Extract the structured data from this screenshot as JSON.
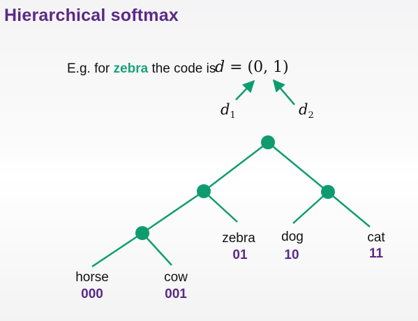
{
  "title": "Hierarchical softmax",
  "example": {
    "prefix": "E.g. for ",
    "word": "zebra",
    "suffix": " the code is",
    "equation": {
      "lhs": "d",
      "equals": " = ",
      "tuple": "(0, 1)"
    },
    "symbol1": {
      "base": "d",
      "sub": "1"
    },
    "symbol2": {
      "base": "d",
      "sub": "2"
    }
  },
  "tree": {
    "leaves": [
      {
        "word": "horse",
        "code": "000"
      },
      {
        "word": "cow",
        "code": "001"
      },
      {
        "word": "zebra",
        "code": "01"
      },
      {
        "word": "dog",
        "code": "10"
      },
      {
        "word": "cat",
        "code": "11"
      }
    ]
  },
  "colors": {
    "title": "#5b2a86",
    "tree": "#0e9c6e",
    "highlight": "#1aa37a",
    "code": "#5b2a86"
  }
}
